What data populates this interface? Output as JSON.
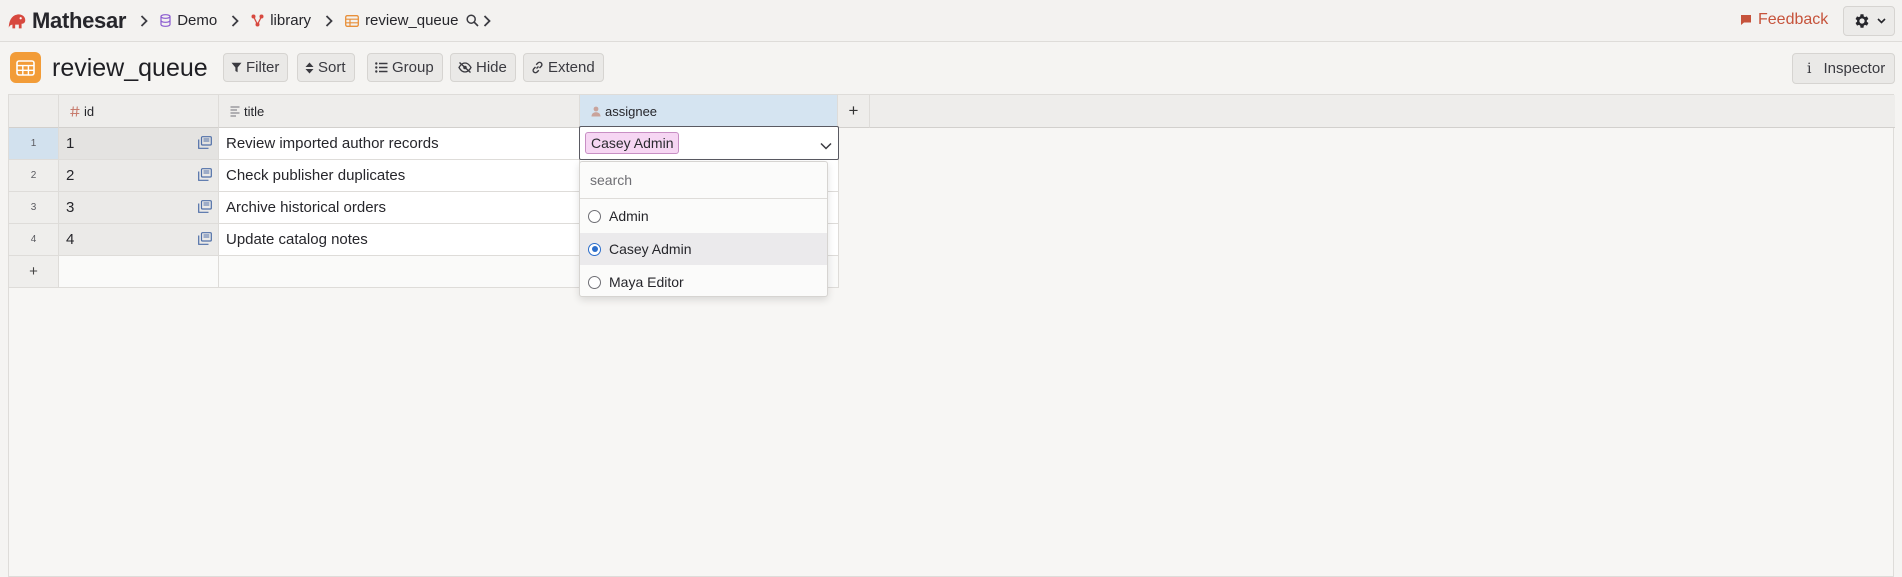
{
  "app": {
    "name": "Mathesar",
    "breadcrumbs": [
      {
        "label": "Demo",
        "icon": "database-icon"
      },
      {
        "label": "library",
        "icon": "schema-icon"
      },
      {
        "label": "review_queue",
        "icon": "table-icon"
      }
    ],
    "feedback_label": "Feedback"
  },
  "toolbar": {
    "title": "review_queue",
    "filter_label": "Filter",
    "sort_label": "Sort",
    "group_label": "Group",
    "hide_label": "Hide",
    "extend_label": "Extend",
    "inspector_label": "Inspector"
  },
  "table": {
    "columns": [
      {
        "name": "id",
        "icon": "hash-icon"
      },
      {
        "name": "title",
        "icon": "text-icon"
      },
      {
        "name": "assignee",
        "icon": "user-icon"
      }
    ],
    "add_column_label": "+",
    "rows": [
      {
        "num": "1",
        "id": "1",
        "title": "Review imported author records"
      },
      {
        "num": "2",
        "id": "2",
        "title": "Check publisher duplicates"
      },
      {
        "num": "3",
        "id": "3",
        "title": "Archive historical orders"
      },
      {
        "num": "4",
        "id": "4",
        "title": "Update catalog notes"
      }
    ],
    "add_row_label": "+"
  },
  "editor": {
    "selected_value": "Casey Admin",
    "search_placeholder": "search",
    "options": [
      {
        "label": "Admin",
        "selected": false
      },
      {
        "label": "Casey Admin",
        "selected": true
      },
      {
        "label": "Maya Editor",
        "selected": false
      }
    ]
  },
  "colors": {
    "accent_orange": "#f29c38",
    "feedback_red": "#c6533b",
    "selected_header": "#d5e4f1",
    "chip_pink": "#f6d6f3",
    "radio_blue": "#2c6ecb"
  }
}
